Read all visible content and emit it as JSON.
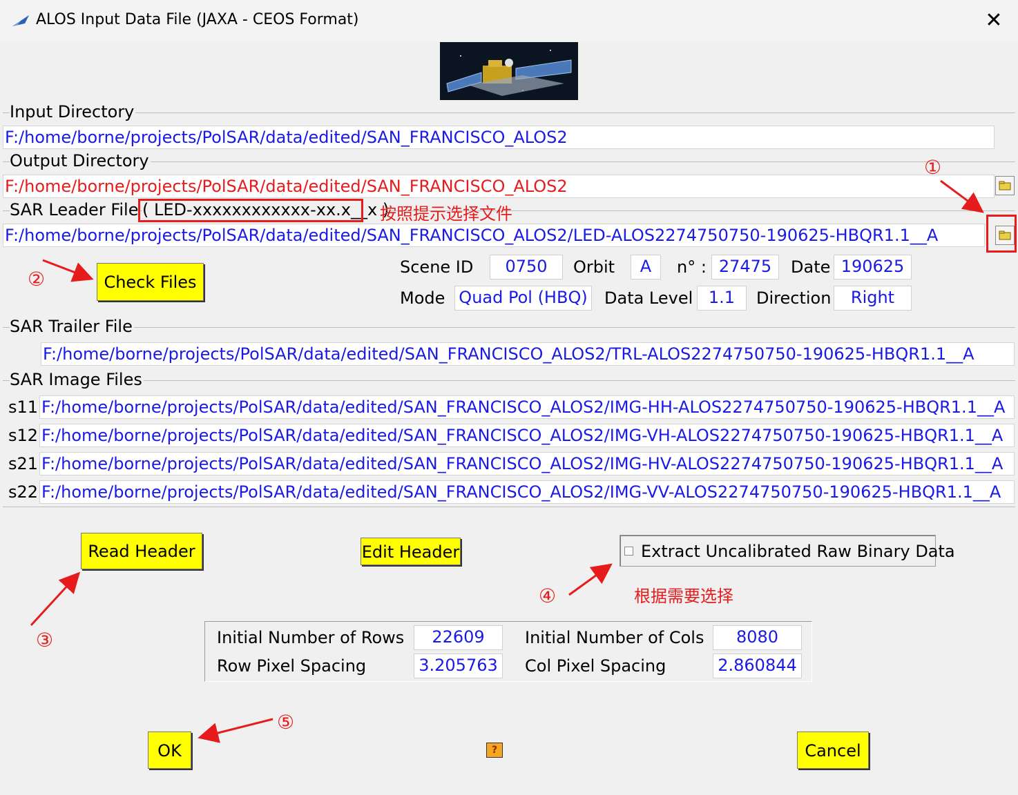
{
  "window": {
    "title": "ALOS Input Data File (JAXA - CEOS Format)"
  },
  "input_dir": {
    "label": "Input Directory",
    "value": "F:/home/borne/projects/PolSAR/data/edited/SAN_FRANCISCO_ALOS2"
  },
  "output_dir": {
    "label": "Output Directory",
    "value": "F:/home/borne/projects/PolSAR/data/edited/SAN_FRANCISCO_ALOS2"
  },
  "leader": {
    "label": "SAR Leader File",
    "hint": "( LED-xxxxxxxxxxxx-xx.x__x )",
    "value": "F:/home/borne/projects/PolSAR/data/edited/SAN_FRANCISCO_ALOS2/LED-ALOS2274750750-190625-HBQR1.1__A"
  },
  "check_files": "Check Files",
  "info": {
    "scene_id_label": "Scene ID",
    "scene_id": "0750",
    "orbit_label": "Orbit",
    "orbit": "A",
    "n_label": "n° :",
    "n": "27475",
    "date_label": "Date",
    "date": "190625",
    "mode_label": "Mode",
    "mode": "Quad Pol (HBQ)",
    "level_label": "Data Level",
    "level": "1.1",
    "direction_label": "Direction",
    "direction": "Right"
  },
  "trailer": {
    "label": "SAR Trailer File",
    "value": "F:/home/borne/projects/PolSAR/data/edited/SAN_FRANCISCO_ALOS2/TRL-ALOS2274750750-190625-HBQR1.1__A"
  },
  "images": {
    "label": "SAR Image Files",
    "rows": [
      {
        "name": "s11",
        "value": "F:/home/borne/projects/PolSAR/data/edited/SAN_FRANCISCO_ALOS2/IMG-HH-ALOS2274750750-190625-HBQR1.1__A"
      },
      {
        "name": "s12",
        "value": "F:/home/borne/projects/PolSAR/data/edited/SAN_FRANCISCO_ALOS2/IMG-VH-ALOS2274750750-190625-HBQR1.1__A"
      },
      {
        "name": "s21",
        "value": "F:/home/borne/projects/PolSAR/data/edited/SAN_FRANCISCO_ALOS2/IMG-HV-ALOS2274750750-190625-HBQR1.1__A"
      },
      {
        "name": "s22",
        "value": "F:/home/borne/projects/PolSAR/data/edited/SAN_FRANCISCO_ALOS2/IMG-VV-ALOS2274750750-190625-HBQR1.1__A"
      }
    ]
  },
  "buttons": {
    "read_header": "Read Header",
    "edit_header": "Edit Header",
    "ok": "OK",
    "cancel": "Cancel",
    "help": "?"
  },
  "extract": {
    "label": "Extract Uncalibrated Raw Binary Data",
    "checked": false
  },
  "stats": {
    "rows_label": "Initial Number of Rows",
    "rows": "22609",
    "cols_label": "Initial Number of Cols",
    "cols": "8080",
    "row_spacing_label": "Row Pixel Spacing",
    "row_spacing": "3.205763",
    "col_spacing_label": "Col Pixel Spacing",
    "col_spacing": "2.860844"
  },
  "annotations": {
    "hint_select_file": "按照提示选择文件",
    "hint_as_needed": "根据需要选择",
    "step1": "①",
    "step2": "②",
    "step3": "③",
    "step4": "④",
    "step5": "⑤"
  },
  "colors": {
    "button": "#ffff00",
    "value_text": "#1a1ae6",
    "annotation": "#e61c1c"
  }
}
